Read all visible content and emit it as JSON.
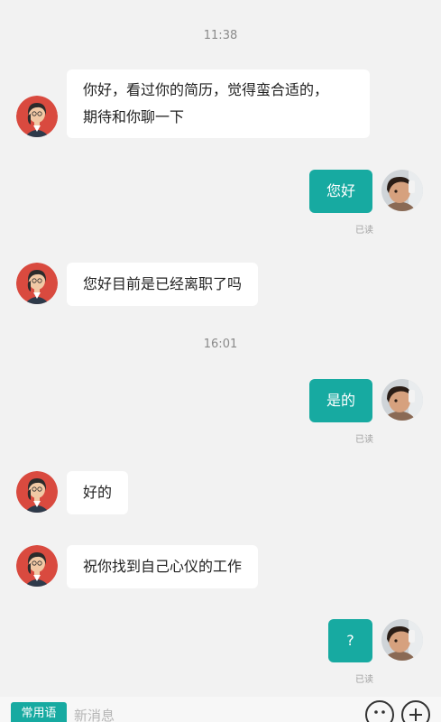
{
  "chat": {
    "timestamp_1": "11:38",
    "msg_1_line_1": "你好，看过你的简历，觉得蛮合适的，",
    "msg_1_line_2": "期待和你聊一下",
    "msg_2": "您好",
    "read_1": "已读",
    "msg_3": "您好目前是已经离职了吗",
    "timestamp_2": "16:01",
    "msg_4": "是的",
    "read_2": "已读",
    "msg_5": "好的",
    "msg_6": "祝你找到自己心仪的工作",
    "msg_7": "?",
    "read_3": "已读"
  },
  "input_bar": {
    "phrases_label": "常用语",
    "placeholder": "新消息"
  },
  "icons": {
    "emoji": "emoji-icon",
    "plus": "plus-icon"
  },
  "colors": {
    "accent": "#17aaa1",
    "background": "#f2f2f2",
    "bubble_incoming": "#ffffff",
    "recruiter_avatar_bg": "#d94a3f"
  }
}
